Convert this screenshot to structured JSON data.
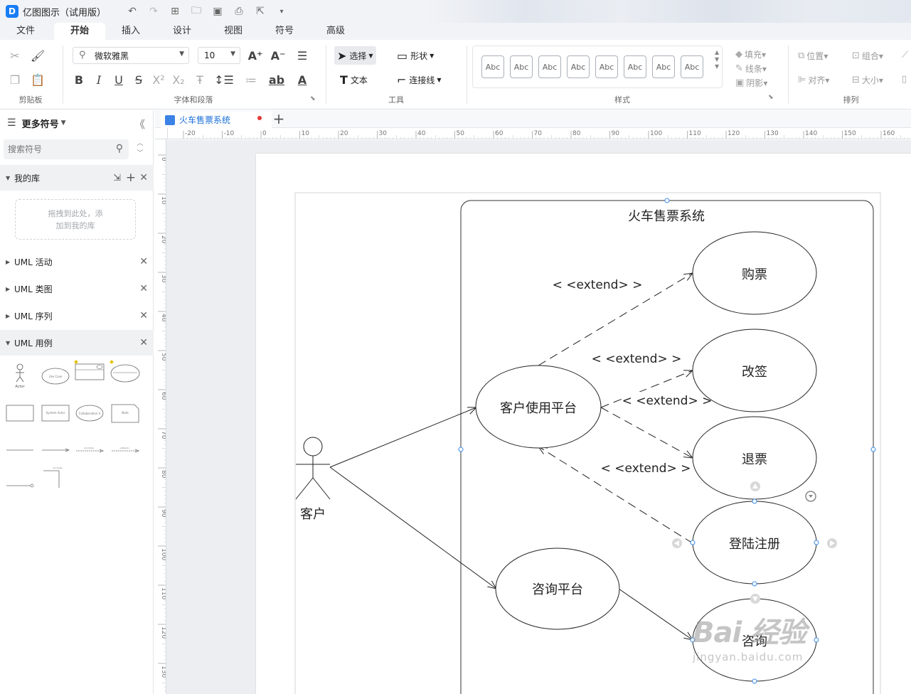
{
  "app": {
    "title": "亿图图示（试用版）",
    "logo_letter": "D"
  },
  "quick_access": {
    "icons": [
      "undo-icon",
      "redo-icon",
      "new-icon",
      "open-icon",
      "save-icon",
      "print-icon",
      "export-icon",
      "more-icon"
    ]
  },
  "menu": {
    "tabs": [
      "文件",
      "开始",
      "插入",
      "设计",
      "视图",
      "符号",
      "高级"
    ],
    "active": "开始"
  },
  "ribbon": {
    "groups": {
      "clipboard": "剪贴板",
      "font": "字体和段落",
      "tools": "工具",
      "styles": "样式",
      "arrange": "排列"
    },
    "font_name": "微软雅黑",
    "font_size": "10",
    "tools": {
      "select": "选择",
      "shape": "形状",
      "text": "文本",
      "connector": "连接线"
    },
    "style_swatches": [
      "Abc",
      "Abc",
      "Abc",
      "Abc",
      "Abc",
      "Abc",
      "Abc",
      "Abc"
    ],
    "format": {
      "fill": "填充",
      "line": "线条",
      "shadow": "阴影"
    },
    "arrange": {
      "position": "位置",
      "group": "组合",
      "align": "对齐",
      "size": "大小"
    }
  },
  "left_panel": {
    "title": "更多符号",
    "search_placeholder": "搜索符号",
    "my_library": "我的库",
    "drop_hint_line1": "拖拽到此处，添",
    "drop_hint_line2": "加到我的库",
    "libraries": [
      "UML 活动",
      "UML 类图",
      "UML 序列",
      "UML 用例"
    ],
    "shape_labels": {
      "actor": "Actor",
      "use_case": "Use Case",
      "system_actor": "System Actor",
      "collaboration": "Collaboration A",
      "note": "Note"
    }
  },
  "document": {
    "tab_title": "火车售票系统",
    "unsaved": true
  },
  "ruler": {
    "h_ticks": [
      "-20",
      "-10",
      "0",
      "10",
      "20",
      "30",
      "40",
      "50",
      "60",
      "70",
      "80",
      "90",
      "100",
      "110",
      "120",
      "130",
      "140",
      "150",
      "160"
    ],
    "v_ticks": [
      "0",
      "10",
      "20",
      "30",
      "40",
      "50",
      "60",
      "70",
      "80",
      "90",
      "100",
      "110",
      "120",
      "130"
    ]
  },
  "diagram": {
    "system_title": "火车售票系统",
    "actor": "客户",
    "use_cases": {
      "platform": "客户使用平台",
      "consult": "咨询平台",
      "buy": "购票",
      "change": "改签",
      "refund": "退票",
      "login": "登陆注册",
      "query": "咨询"
    },
    "relations": {
      "extend1": "< <extend> >",
      "extend2": "< <extend> >",
      "extend3": "< <extend> >",
      "extend4": "< <extend> >"
    }
  },
  "watermark": {
    "main": "Bai  经验",
    "sub": "jingyan.baidu.com"
  }
}
